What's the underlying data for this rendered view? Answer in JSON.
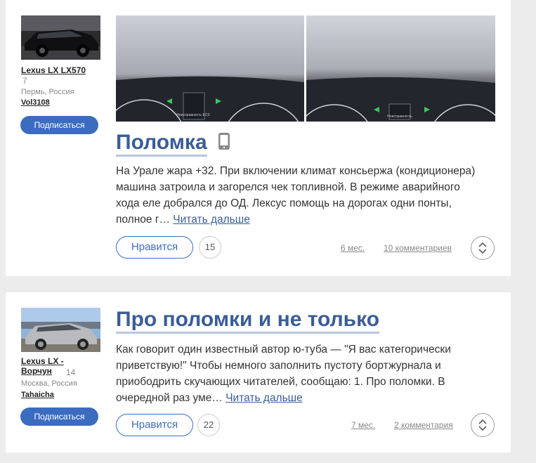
{
  "posts": [
    {
      "car_name": "Lexus LX LX570",
      "car_count": "7",
      "location": "Пермь, Россия",
      "user": "Vol3108",
      "subscribe_label": "Подписаться",
      "title": "Поломка",
      "excerpt": "На Урале жара +32. При включении климат консьержа (кондиционера) машина затроила и загорелся чек топливной. В режиме аварийного хода еле добрался до ОД. Лексус помощь на дорогах одни понты, полное г…",
      "read_more": "Читать дальше",
      "like_label": "Нравится",
      "likes": "15",
      "time": "6 мес.",
      "comments": "10 комментариев",
      "photo_caption_1": "Неисправность ECS",
      "photo_caption_2": "Неисправность"
    },
    {
      "car_name": "Lexus LX - Ворчун",
      "car_count": "14",
      "location": "Москва, Россия",
      "user": "Tahaicha",
      "subscribe_label": "Подписаться",
      "title": "Про поломки и не только",
      "excerpt": "Как говорит один известный автор ю-туба — \"Я вас категорически приветствую!\" Чтобы немного заполнить пустоту бортжурнала и приободрить скучающих читателей, сообщаю: 1. Про поломки. В очередной раз уме…",
      "read_more": "Читать дальше",
      "like_label": "Нравится",
      "likes": "22",
      "time": "7 мес.",
      "comments": "2 комментария"
    }
  ]
}
